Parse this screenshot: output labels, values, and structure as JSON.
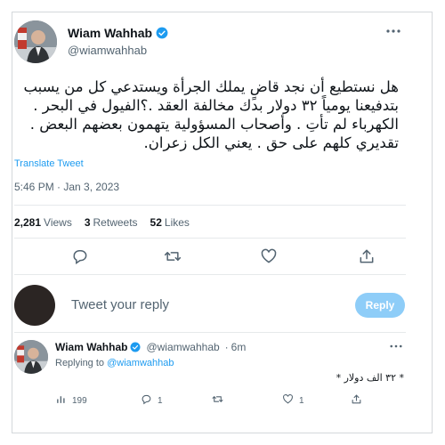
{
  "tweet": {
    "author_name": "Wiam Wahhab",
    "author_handle": "@wiamwahhab",
    "text": "هل نستطيع أن نجد قاضٍ يملك الجرأة ويستدعي كل من يسبب بتدفيعنا يومياً ٣٢ دولار بدك مخالفة العقد .؟الفيول في البحر . الكهرباء لم تأتِ . وأصحاب المسؤولية يتهمون بعضهم البعض . تقديري كلهم على حق . يعني الكل زعران.",
    "translate_label": "Translate Tweet",
    "timestamp": "5:46 PM · Jan 3, 2023",
    "stats": {
      "views_count": "2,281",
      "views_label": "Views",
      "retweets_count": "3",
      "retweets_label": "Retweets",
      "likes_count": "52",
      "likes_label": "Likes"
    }
  },
  "reply_composer": {
    "placeholder": "Tweet your reply",
    "button_label": "Reply"
  },
  "reply_tweet": {
    "author_name": "Wiam Wahhab",
    "author_handle": "@wiamwahhab",
    "age": "6m",
    "replying_prefix": "Replying to",
    "replying_to": "@wiamwahhab",
    "text": "* ٣٢ الف دولار *",
    "views_count": "199",
    "replies_count": "1",
    "likes_count": "1"
  },
  "icons": {
    "verified": "verified-badge-icon",
    "more": "more-horizontal-icon",
    "reply": "reply-icon",
    "retweet": "retweet-icon",
    "like": "like-icon",
    "share": "share-icon",
    "views": "views-icon"
  },
  "colors": {
    "accent": "#1d9bf0",
    "reply_button": "#8ecdf8",
    "secondary_text": "#536471"
  }
}
